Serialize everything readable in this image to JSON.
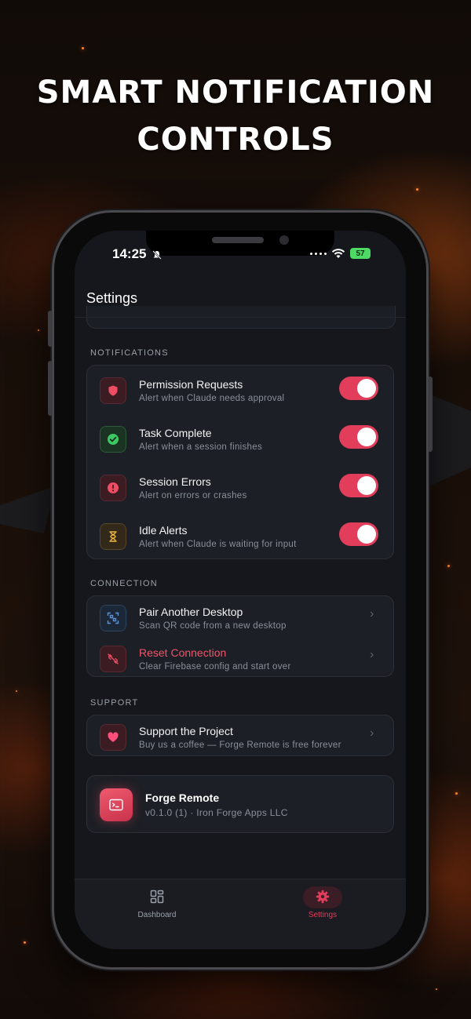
{
  "headline": {
    "line1": "Smart Notification",
    "line2": "Controls"
  },
  "status_bar": {
    "time": "14:25",
    "battery": "57"
  },
  "header": {
    "title": "Settings"
  },
  "notifications": {
    "section_label": "NOTIFICATIONS",
    "items": [
      {
        "title": "Permission Requests",
        "subtitle": "Alert when Claude needs approval",
        "icon": "shield-icon",
        "enabled": true
      },
      {
        "title": "Task Complete",
        "subtitle": "Alert when a session finishes",
        "icon": "check-circle-icon",
        "enabled": true
      },
      {
        "title": "Session Errors",
        "subtitle": "Alert on errors or crashes",
        "icon": "alert-circle-icon",
        "enabled": true
      },
      {
        "title": "Idle Alerts",
        "subtitle": "Alert when Claude is waiting for input",
        "icon": "hourglass-icon",
        "enabled": true
      }
    ]
  },
  "connection": {
    "section_label": "CONNECTION",
    "items": [
      {
        "title": "Pair Another Desktop",
        "subtitle": "Scan QR code from a new desktop",
        "icon": "qr-scan-icon"
      },
      {
        "title": "Reset Connection",
        "subtitle": "Clear Firebase config and start over",
        "icon": "unlink-icon"
      }
    ]
  },
  "support": {
    "section_label": "SUPPORT",
    "items": [
      {
        "title": "Support the Project",
        "subtitle": "Buy us a coffee — Forge Remote is free forever",
        "icon": "heart-icon"
      }
    ]
  },
  "app_info": {
    "name": "Forge Remote",
    "version": "v0.1.0 (1) · Iron Forge Apps LLC",
    "icon": "terminal-icon"
  },
  "tabbar": {
    "tabs": [
      {
        "label": "Dashboard",
        "icon": "dashboard-icon",
        "active": false
      },
      {
        "label": "Settings",
        "icon": "gear-icon",
        "active": true
      }
    ]
  },
  "colors": {
    "accent": "#e23e5b",
    "background": "#15171c",
    "card": "#1c1f25"
  }
}
